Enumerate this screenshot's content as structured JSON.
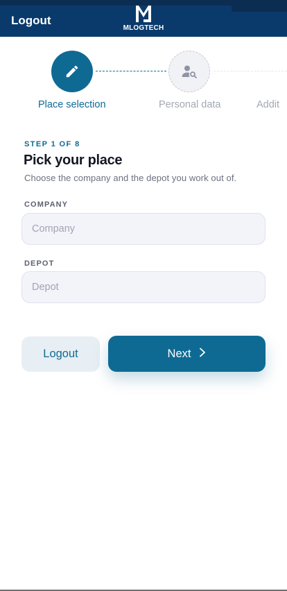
{
  "header": {
    "logout_label": "Logout",
    "brand_name": "MLOGTECH"
  },
  "stepper": {
    "steps": [
      {
        "label": "Place selection",
        "icon": "pencil-icon",
        "state": "active"
      },
      {
        "label": "Personal data",
        "icon": "user-search-icon",
        "state": "pending"
      },
      {
        "label": "Addit",
        "state": "pending"
      }
    ]
  },
  "form": {
    "step_counter": "STEP 1 OF 8",
    "title": "Pick your place",
    "subtitle": "Choose the company and the depot you work out of.",
    "company": {
      "label": "COMPANY",
      "placeholder": "Company",
      "value": ""
    },
    "depot": {
      "label": "DEPOT",
      "placeholder": "Depot",
      "value": ""
    }
  },
  "actions": {
    "logout_label": "Logout",
    "next_label": "Next",
    "next_icon": "chevron-right-icon"
  },
  "colors": {
    "header_bg": "#0a3a6b",
    "accent": "#0e6a93",
    "pending": "#a5a8b4"
  }
}
